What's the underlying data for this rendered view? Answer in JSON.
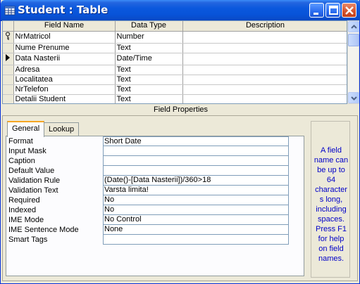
{
  "window": {
    "title": "Student : Table"
  },
  "grid": {
    "headers": [
      "Field Name",
      "Data Type",
      "Description"
    ],
    "rows": [
      {
        "field_name": "NrMatricol",
        "data_type": "Number",
        "description": ""
      },
      {
        "field_name": "Nume Prenume",
        "data_type": "Text",
        "description": ""
      },
      {
        "field_name": "Data Nasterii",
        "data_type": "Date/Time",
        "description": ""
      },
      {
        "field_name": "Adresa",
        "data_type": "Text",
        "description": ""
      },
      {
        "field_name": "Localitatea",
        "data_type": "Text",
        "description": ""
      },
      {
        "field_name": "NrTelefon",
        "data_type": "Text",
        "description": ""
      },
      {
        "field_name": "Detalii Student",
        "data_type": "Text",
        "description": ""
      }
    ]
  },
  "field_properties": {
    "label": "Field Properties",
    "tabs": [
      {
        "label": "General"
      },
      {
        "label": "Lookup"
      }
    ],
    "properties": [
      {
        "name": "Format",
        "value": "Short Date"
      },
      {
        "name": "Input Mask",
        "value": ""
      },
      {
        "name": "Caption",
        "value": ""
      },
      {
        "name": "Default Value",
        "value": ""
      },
      {
        "name": "Validation Rule",
        "value": "(Date()-[Data Nasterii])/360>18"
      },
      {
        "name": "Validation Text",
        "value": "Varsta limita!"
      },
      {
        "name": "Required",
        "value": "No"
      },
      {
        "name": "Indexed",
        "value": "No"
      },
      {
        "name": "IME Mode",
        "value": "No Control"
      },
      {
        "name": "IME Sentence Mode",
        "value": "None"
      },
      {
        "name": "Smart Tags",
        "value": ""
      }
    ],
    "help_text": "A field name can be up to 64 character s long, including spaces. Press F1 for help on field names."
  }
}
